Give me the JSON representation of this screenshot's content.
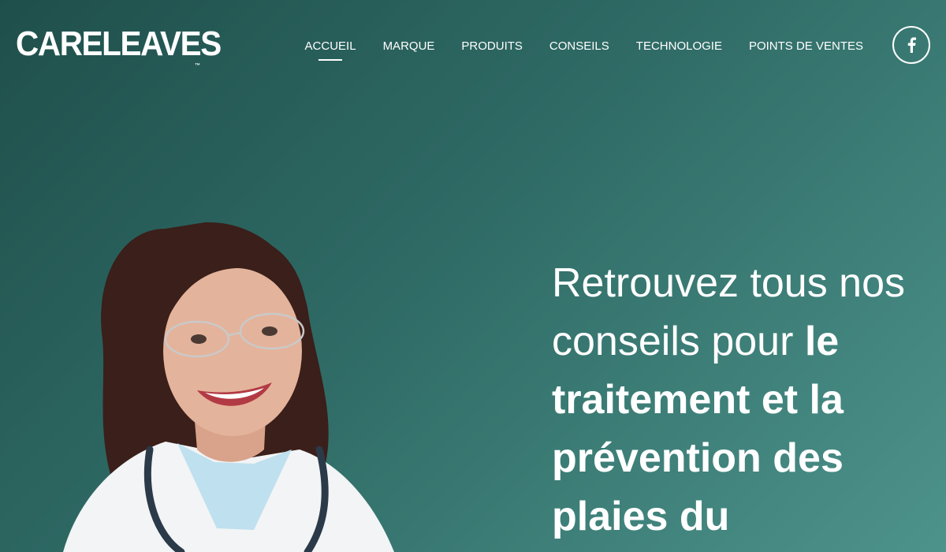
{
  "brand": {
    "logo_text": "CARELEAVES",
    "trademark": "™"
  },
  "nav": {
    "items": [
      {
        "label": "ACCUEIL",
        "active": true
      },
      {
        "label": "MARQUE",
        "active": false
      },
      {
        "label": "PRODUITS",
        "active": false
      },
      {
        "label": "CONSEILS",
        "active": false
      },
      {
        "label": "TECHNOLOGIE",
        "active": false
      },
      {
        "label": "POINTS DE VENTES",
        "active": false
      }
    ],
    "social_icon": "facebook-icon"
  },
  "hero": {
    "headline_light": "Retrouvez tous nos conseils pour ",
    "headline_bold": "le traitement et la prévention des plaies du"
  },
  "colors": {
    "background_start": "#1f4f4b",
    "background_end": "#4d928b",
    "text": "#ffffff"
  }
}
